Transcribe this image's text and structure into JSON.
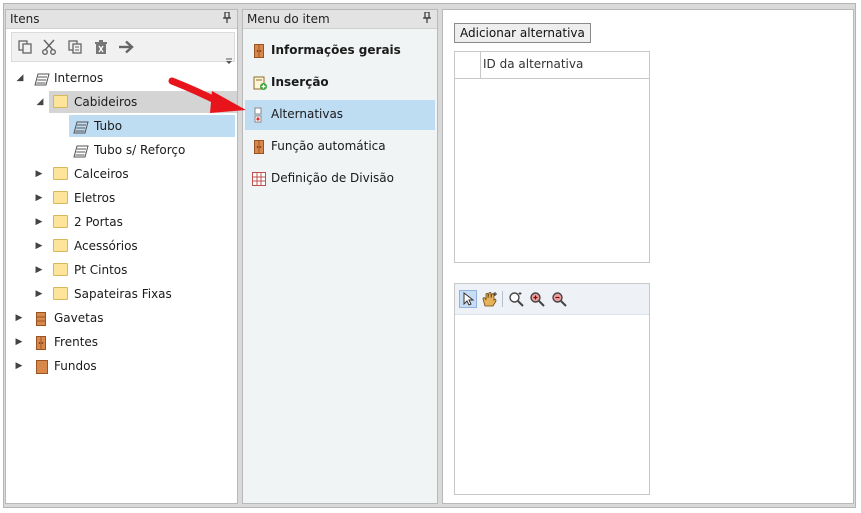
{
  "panels": {
    "items": {
      "title": "Itens",
      "pin": "ᵖ"
    },
    "menu": {
      "title": "Menu do item",
      "pin": "ᵖ"
    }
  },
  "toolbar": {
    "buttons": [
      "copy-icon",
      "cut-icon",
      "paste-icon",
      "delete-icon",
      "arrow-right-icon"
    ]
  },
  "tree": {
    "internos": "Internos",
    "cabideiros": "Cabideiros",
    "tubo": "Tubo",
    "tubo_reforco": "Tubo s/ Reforço",
    "calceiros": "Calceiros",
    "eletros": "Eletros",
    "portas": "2 Portas",
    "acessorios": "Acessórios",
    "pt_cintos": "Pt Cintos",
    "sapateiras": "Sapateiras Fixas",
    "gavetas": "Gavetas",
    "frentes": "Frentes",
    "fundos": "Fundos"
  },
  "menu_items": {
    "informacoes": "Informações gerais",
    "insercao": "Inserção",
    "alternativas": "Alternativas",
    "funcao": "Função automática",
    "definicao": "Definição de Divisão"
  },
  "alternatives": {
    "add_button": "Adicionar alternativa",
    "id_column": "ID da alternativa"
  },
  "viewer_tools": [
    "pointer-icon",
    "pan-hand-icon",
    "zoom-fit-icon",
    "zoom-in-icon",
    "zoom-out-icon"
  ],
  "colors": {
    "selection": "#bedcf2",
    "folder": "#fce59a",
    "annotation_arrow": "#e8141c"
  }
}
